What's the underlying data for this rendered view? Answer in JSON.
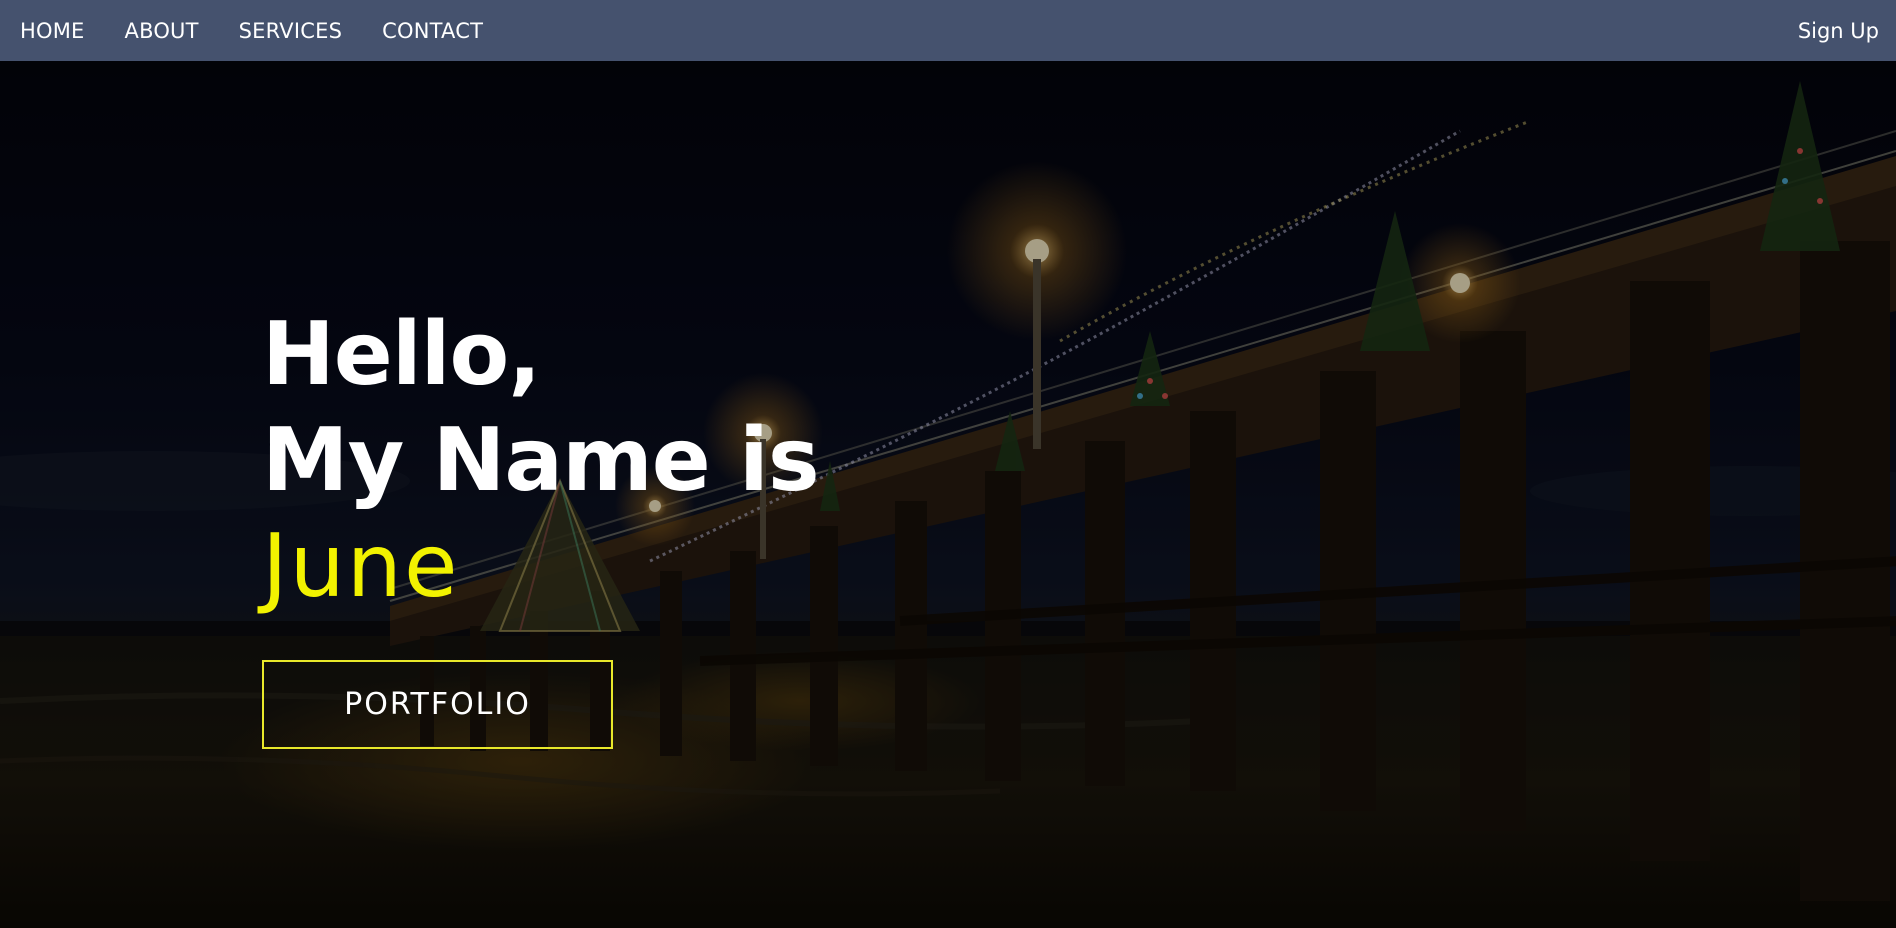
{
  "nav": {
    "links": [
      "HOME",
      "ABOUT",
      "SERVICES",
      "CONTACT"
    ],
    "signup": "Sign Up"
  },
  "hero": {
    "line1": "Hello,",
    "line2": "My Name is",
    "name": "June",
    "button": "PORTFOLIO",
    "background": "night-pier-with-christmas-lights-photo"
  },
  "colors": {
    "navbar": "#45526e",
    "accent": "#f2f200",
    "text": "#ffffff"
  }
}
